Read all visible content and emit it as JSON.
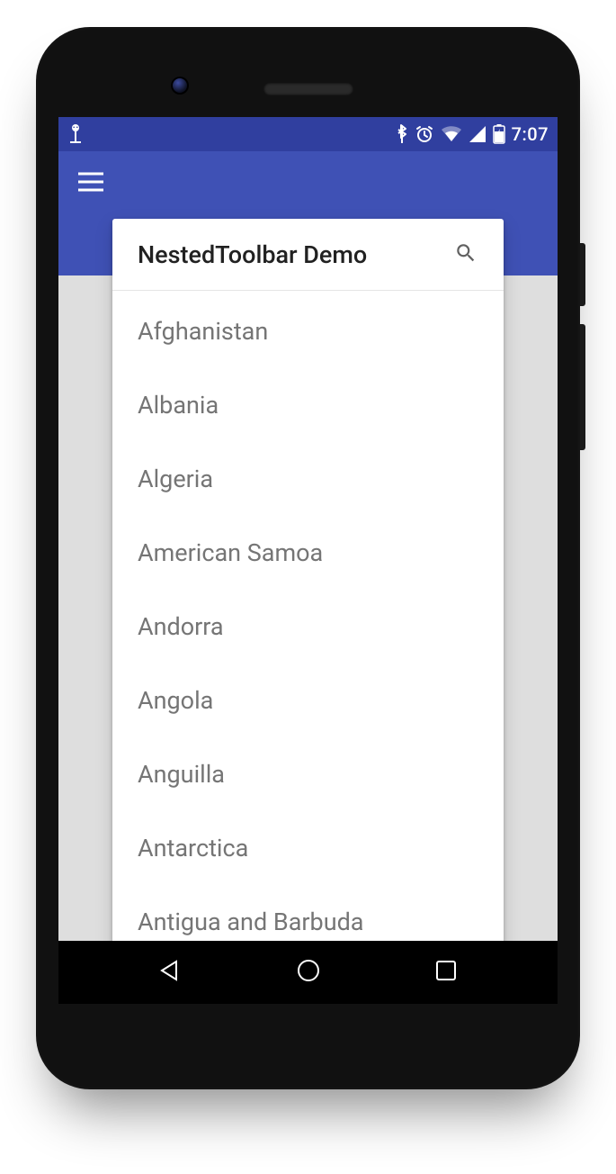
{
  "statusbar": {
    "clock": "7:07"
  },
  "app": {
    "toolbar_title": "NestedToolbar Demo"
  },
  "list": {
    "items": [
      "Afghanistan",
      "Albania",
      "Algeria",
      "American Samoa",
      "Andorra",
      "Angola",
      "Anguilla",
      "Antarctica",
      "Antigua and Barbuda"
    ]
  },
  "colors": {
    "primary": "#3f51b5",
    "primary_dark": "#303f9f",
    "background": "#dedede"
  }
}
